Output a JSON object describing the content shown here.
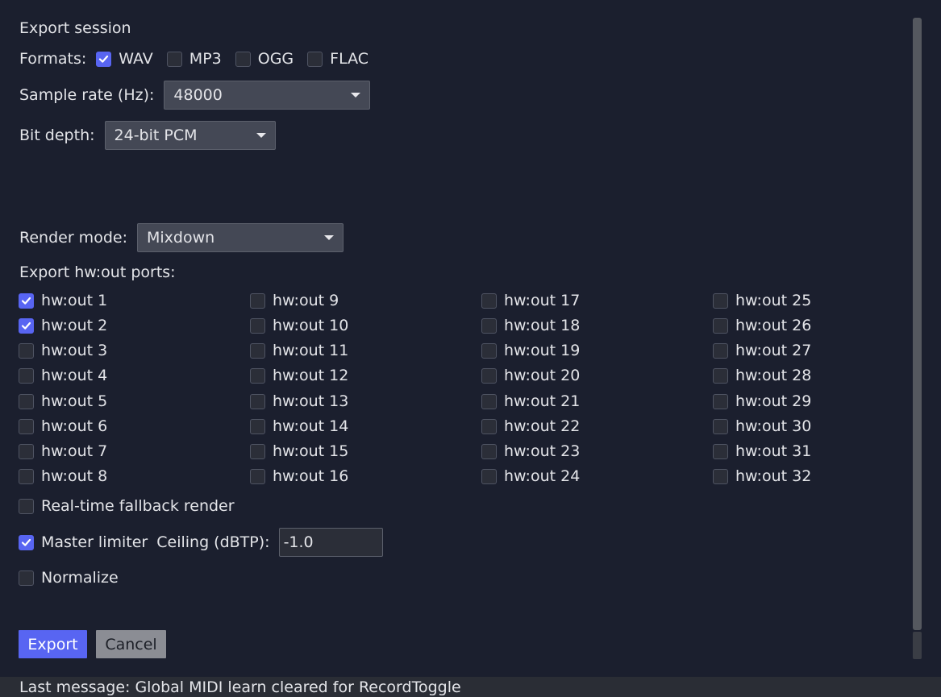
{
  "title": "Export session",
  "formats": {
    "label": "Formats:",
    "options": [
      {
        "label": "WAV",
        "checked": true
      },
      {
        "label": "MP3",
        "checked": false
      },
      {
        "label": "OGG",
        "checked": false
      },
      {
        "label": "FLAC",
        "checked": false
      }
    ]
  },
  "sample_rate": {
    "label": "Sample rate (Hz):",
    "value": "48000"
  },
  "bit_depth": {
    "label": "Bit depth:",
    "value": "24-bit PCM"
  },
  "render_mode": {
    "label": "Render mode:",
    "value": "Mixdown"
  },
  "ports": {
    "label": "Export hw:out ports:",
    "items": [
      {
        "label": "hw:out 1",
        "checked": true
      },
      {
        "label": "hw:out 2",
        "checked": true
      },
      {
        "label": "hw:out 3",
        "checked": false
      },
      {
        "label": "hw:out 4",
        "checked": false
      },
      {
        "label": "hw:out 5",
        "checked": false
      },
      {
        "label": "hw:out 6",
        "checked": false
      },
      {
        "label": "hw:out 7",
        "checked": false
      },
      {
        "label": "hw:out 8",
        "checked": false
      },
      {
        "label": "hw:out 9",
        "checked": false
      },
      {
        "label": "hw:out 10",
        "checked": false
      },
      {
        "label": "hw:out 11",
        "checked": false
      },
      {
        "label": "hw:out 12",
        "checked": false
      },
      {
        "label": "hw:out 13",
        "checked": false
      },
      {
        "label": "hw:out 14",
        "checked": false
      },
      {
        "label": "hw:out 15",
        "checked": false
      },
      {
        "label": "hw:out 16",
        "checked": false
      },
      {
        "label": "hw:out 17",
        "checked": false
      },
      {
        "label": "hw:out 18",
        "checked": false
      },
      {
        "label": "hw:out 19",
        "checked": false
      },
      {
        "label": "hw:out 20",
        "checked": false
      },
      {
        "label": "hw:out 21",
        "checked": false
      },
      {
        "label": "hw:out 22",
        "checked": false
      },
      {
        "label": "hw:out 23",
        "checked": false
      },
      {
        "label": "hw:out 24",
        "checked": false
      },
      {
        "label": "hw:out 25",
        "checked": false
      },
      {
        "label": "hw:out 26",
        "checked": false
      },
      {
        "label": "hw:out 27",
        "checked": false
      },
      {
        "label": "hw:out 28",
        "checked": false
      },
      {
        "label": "hw:out 29",
        "checked": false
      },
      {
        "label": "hw:out 30",
        "checked": false
      },
      {
        "label": "hw:out 31",
        "checked": false
      },
      {
        "label": "hw:out 32",
        "checked": false
      }
    ]
  },
  "realtime_fallback": {
    "label": "Real-time fallback render",
    "checked": false
  },
  "master_limiter": {
    "label": "Master limiter",
    "checked": true,
    "ceiling_label": "Ceiling (dBTP):",
    "ceiling_value": "-1.0"
  },
  "normalize": {
    "label": "Normalize",
    "checked": false
  },
  "buttons": {
    "export": "Export",
    "cancel": "Cancel"
  },
  "status": {
    "text": "Last message: Global MIDI learn cleared for RecordToggle"
  },
  "colors": {
    "accent": "#5865f2",
    "background": "#1b1f2e",
    "status_bar": "#2a2d35"
  }
}
